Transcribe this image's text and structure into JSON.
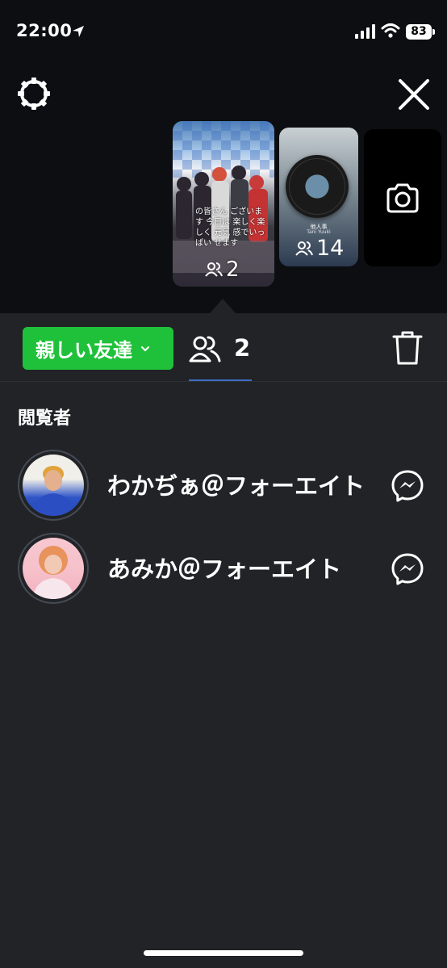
{
  "status_bar": {
    "time": "22:00",
    "battery": "83"
  },
  "stories": {
    "main": {
      "caption": "の皆さん ございます 今日は 楽しく楽しく 元気 感でいっぱい せます",
      "viewer_count": "2"
    },
    "second": {
      "song_title": "他人事",
      "song_artist": "Tani Yuuki",
      "viewer_count": "14"
    },
    "camera": {
      "icon": "camera-icon"
    }
  },
  "toolbar": {
    "audience_label": "親しい友達",
    "viewer_count": "2"
  },
  "viewers": {
    "title": "閲覧者",
    "list": [
      {
        "name": "わかぢぁ＠フォーエイト"
      },
      {
        "name": "あみか＠フォーエイト"
      }
    ]
  },
  "colors": {
    "accent_green": "#1fc13a",
    "background": "#212327",
    "top_background": "#0c0e12",
    "tab_underline": "#3e6ec2"
  }
}
